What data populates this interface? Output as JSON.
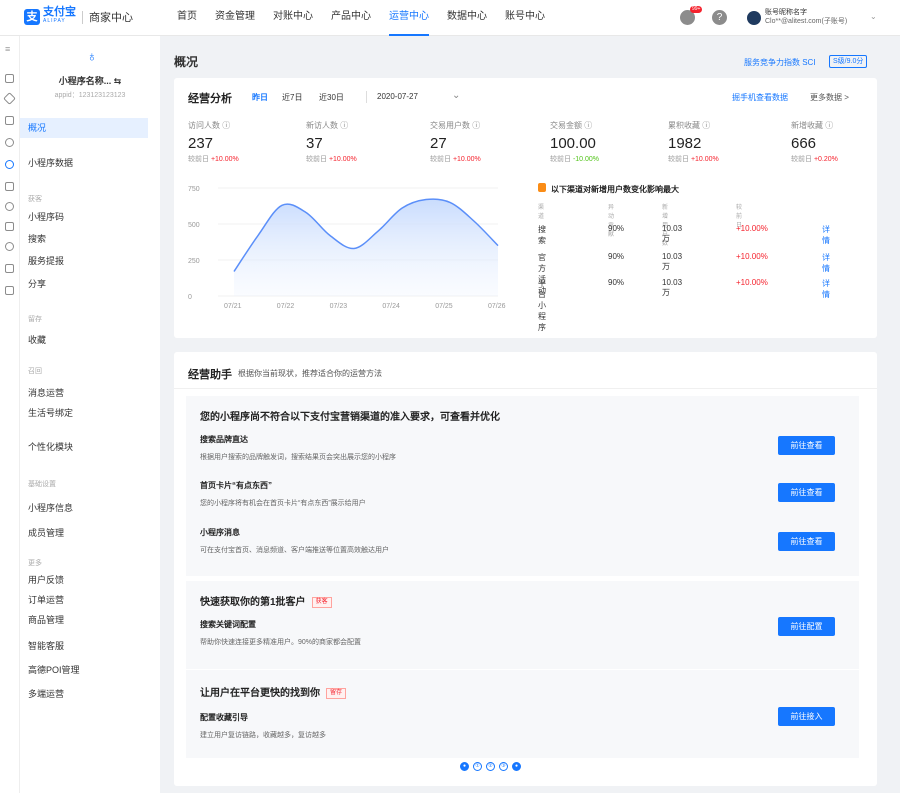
{
  "brand": {
    "logo_cn": "支付宝",
    "logo_en": "ALIPAY",
    "title": "商家中心",
    "color": "#1677ff"
  },
  "nav": [
    "首页",
    "资金管理",
    "对账中心",
    "产品中心",
    "运营中心",
    "数据中心",
    "账号中心"
  ],
  "nav_active": "运营中心",
  "header": {
    "badge": "99+",
    "account_name": "账号昵称名字",
    "account_email": "Clo**@alitest.com(子账号)"
  },
  "app": {
    "name": "小程序名称... ⇆",
    "appid": "appid：123123123123"
  },
  "sidebar": {
    "overview": "概况",
    "data": "小程序数据",
    "group_acquire": "获客",
    "acquire": [
      "小程序码",
      "搜索",
      "服务提报",
      "分享"
    ],
    "group_retain": "留存",
    "retain": [
      "收藏"
    ],
    "group_repeat": "召回",
    "repeat": [
      "消息运营",
      "生活号绑定"
    ],
    "personal": "个性化模块",
    "group_basic": "基础设置",
    "basic": [
      "小程序信息",
      "成员管理"
    ],
    "group_more": "更多",
    "more": [
      "用户反馈",
      "订单运营",
      "商品管理",
      "智能客服",
      "高德POI管理",
      "多端运营"
    ]
  },
  "page": {
    "title": "概况",
    "sci_text": "服务竞争力指数 SCI",
    "sci_badge": "S级/9.0分"
  },
  "analysis": {
    "title": "经营分析",
    "ranges": [
      "昨日",
      "近7日",
      "近30日"
    ],
    "date": "2020-07-27",
    "mobile_link": "掘手机查看数据",
    "more_link": "更多数据 >",
    "compare_prefix": "较前日",
    "metrics": [
      {
        "label": "访问人数 ⓘ",
        "value": "237",
        "delta": "+10.00%",
        "dir": "up"
      },
      {
        "label": "新访人数 ⓘ",
        "value": "37",
        "delta": "+10.00%",
        "dir": "up"
      },
      {
        "label": "交易用户数 ⓘ",
        "value": "27",
        "delta": "+10.00%",
        "dir": "up"
      },
      {
        "label": "交易金额 ⓘ",
        "value": "100.00",
        "delta": "-10.00%",
        "dir": "down"
      },
      {
        "label": "累积收藏 ⓘ",
        "value": "1982",
        "delta": "+10.00%",
        "dir": "up"
      },
      {
        "label": "新增收藏 ⓘ",
        "value": "666",
        "delta": "+0.20%",
        "dir": "up"
      }
    ],
    "channels_title": "以下渠道对新增用户数变化影响最大",
    "channel_headers": [
      "渠道",
      "异动贡献",
      "新增用户数",
      "较前日"
    ],
    "channels": [
      {
        "name": "搜索",
        "contribution": "90%",
        "users": "10.03万",
        "delta": "+10.00%",
        "link": "详情"
      },
      {
        "name": "官方活动",
        "contribution": "90%",
        "users": "10.03万",
        "delta": "+10.00%",
        "link": "详情"
      },
      {
        "name": "平台小程序",
        "contribution": "90%",
        "users": "10.03万",
        "delta": "+10.00%",
        "link": "详情"
      }
    ]
  },
  "chart_data": {
    "type": "area",
    "categories": [
      "07/21",
      "07/22",
      "07/23",
      "07/24",
      "07/25",
      "07/26"
    ],
    "x": [
      0,
      1,
      2,
      3,
      4,
      5,
      6,
      7,
      8,
      9,
      10,
      11
    ],
    "values": [
      170,
      420,
      630,
      580,
      420,
      330,
      450,
      610,
      670,
      650,
      520,
      350
    ],
    "y_ticks": [
      "750",
      "500",
      "250",
      "0"
    ],
    "ylim": [
      0,
      750
    ],
    "line_color": "#5b8ff9"
  },
  "assistant": {
    "title": "经营助手",
    "subtitle": "根据你当前现状，推荐适合你的运营方法",
    "sections": [
      {
        "heading": "您的小程序尚不符合以下支付宝营销渠道的准入要求，可查看并优化",
        "tag": "",
        "items": [
          {
            "title": "搜索品牌直达",
            "desc": "根据用户搜索的品牌触发词，搜索结果页会突出展示您的小程序",
            "button": "前往查看"
          },
          {
            "title": "首页卡片“有点东西”",
            "desc": "您的小程序将有机会在首页卡片“有点东西”展示给用户",
            "button": "前往查看"
          },
          {
            "title": "小程序消息",
            "desc": "可在支付宝首页、消息频道、客户端推送等位置高效触达用户",
            "button": "前往查看"
          }
        ]
      },
      {
        "heading": "快速获取你的第1批客户",
        "tag": "获客",
        "items": [
          {
            "title": "搜索关键词配置",
            "desc": "帮助你快速连接更多精准用户。90%的商家都会配置",
            "button": "前往配置"
          }
        ]
      },
      {
        "heading": "让用户在平台更快的找到你",
        "tag": "留存",
        "items": [
          {
            "title": "配置收藏引导",
            "desc": "建立用户复访链路，收藏越多，复访越多",
            "button": "前往接入"
          }
        ]
      }
    ]
  },
  "pagination": [
    "●",
    "①",
    "②",
    "③",
    "●"
  ]
}
